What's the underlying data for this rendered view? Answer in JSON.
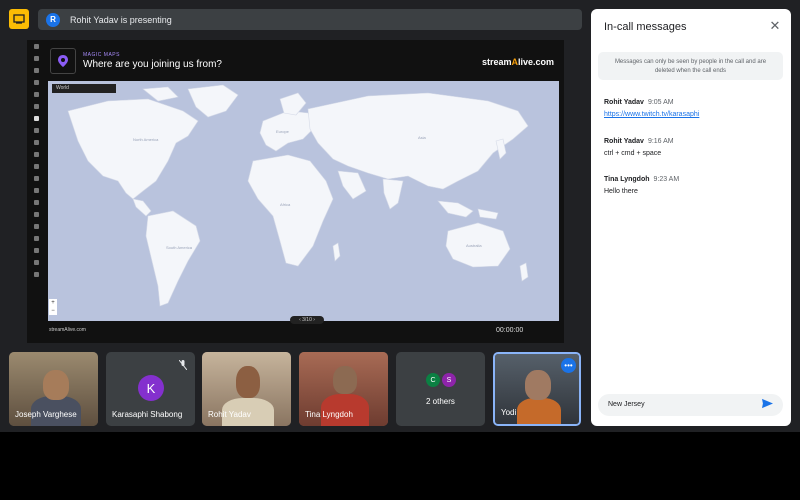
{
  "presenting": {
    "avatar_letter": "R",
    "text": "Rohit Yadav is presenting"
  },
  "shared_screen": {
    "brand_small": "MAGIC MAPS",
    "title": "Where are you joining us from?",
    "logo": "stream",
    "logo_suffix": "live.com",
    "map_select": "World",
    "footer_brand": "streamAlive.com",
    "page_indicator": "‹ 3/10 ›",
    "timer": "00:00:00"
  },
  "tiles": [
    {
      "name": "Joseph Varghese"
    },
    {
      "name": "Karasaphi Shabong",
      "avatar_letter": "K",
      "avatar_color": "#8430ce"
    },
    {
      "name": "Rohit Yadav"
    },
    {
      "name": "Tina Lyngdoh"
    },
    {
      "name": "2 others",
      "avatars": [
        {
          "letter": "C",
          "color": "#0b8043"
        },
        {
          "letter": "S",
          "color": "#8e24aa"
        }
      ]
    },
    {
      "name": "Yodi"
    }
  ],
  "chat": {
    "title": "In-call messages",
    "notice": "Messages can only be seen by people in the call and are deleted when the call ends",
    "messages": [
      {
        "sender": "Rohit Yadav",
        "time": "9:05 AM",
        "text": "https://www.twitch.tv/karasaphi",
        "is_link": true
      },
      {
        "sender": "Rohit Yadav",
        "time": "9:16 AM",
        "text": "ctrl + cmd + space",
        "is_link": false
      },
      {
        "sender": "Tina Lyngdoh",
        "time": "9:23 AM",
        "text": "Hello there",
        "is_link": false
      }
    ],
    "input_value": "New Jersey"
  },
  "colors": {
    "accent": "#1a73e8",
    "present_icon": "#fbbc04",
    "background": "#202124"
  }
}
